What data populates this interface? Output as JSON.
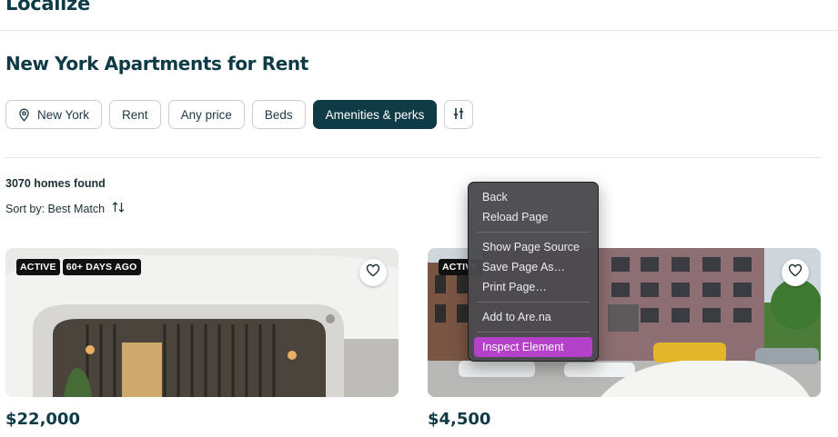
{
  "header": {
    "logo": "Localize"
  },
  "page": {
    "title": "New York Apartments for Rent"
  },
  "filters": {
    "location": "New York",
    "listing_type": "Rent",
    "price": "Any price",
    "beds": "Beds",
    "amenities": "Amenities & perks"
  },
  "results": {
    "count_text": "3070 homes found",
    "sort_text": "Sort by: Best Match"
  },
  "listings": [
    {
      "status": "ACTIVE",
      "age": "60+ DAYS AGO",
      "price": "$22,000"
    },
    {
      "status": "ACTIVE",
      "price": "$4,500"
    }
  ],
  "context_menu": {
    "groups": [
      [
        "Back",
        "Reload Page"
      ],
      [
        "Show Page Source",
        "Save Page As…",
        "Print Page…"
      ],
      [
        "Add to Are.na"
      ],
      [
        "Inspect Element"
      ]
    ],
    "highlighted": "Inspect Element"
  },
  "colors": {
    "brand": "#0f3b47",
    "menu_highlight": "#b540c9",
    "badge_bg": "#111111"
  },
  "icons": [
    "location-pin-icon",
    "filter-sliders-icon",
    "sort-arrows-icon",
    "heart-icon"
  ]
}
